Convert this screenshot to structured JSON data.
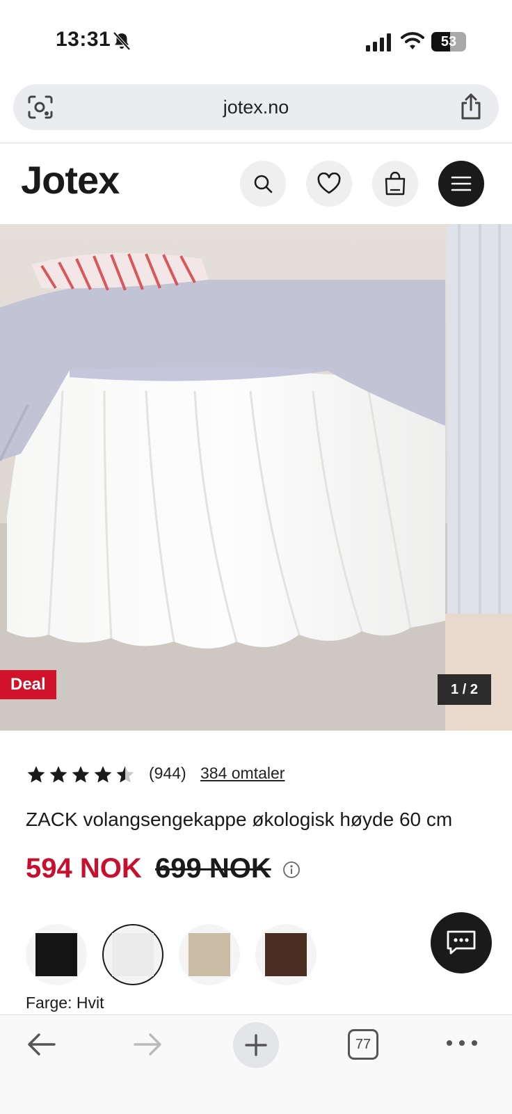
{
  "status_bar": {
    "time": "13:31",
    "battery": "53",
    "battery_level": 0.53
  },
  "browser": {
    "url": "jotex.no",
    "tab_count": "77"
  },
  "header": {
    "logo": "Jotex"
  },
  "gallery": {
    "badge": "Deal",
    "counter": "1 / 2"
  },
  "product": {
    "rating": 4.5,
    "rating_count": "(944)",
    "reviews_link": "384 omtaler",
    "title": "ZACK volangsengekappe økologisk høyde 60 cm",
    "sale_price": "594 NOK",
    "old_price": "699 NOK",
    "color_label": "Farge: Hvit",
    "swatches": [
      {
        "color": "#141414",
        "selected": false
      },
      {
        "color": "#ebebeb",
        "selected": true
      },
      {
        "color": "#c9bba4",
        "selected": false
      },
      {
        "color": "#4a2e22",
        "selected": false
      }
    ]
  },
  "colors": {
    "accent": "#c8102e",
    "deal_badge": "#d0122a",
    "dark": "#1a1a1a"
  },
  "icons": [
    "bell-slash-icon",
    "signal-icon",
    "wifi-icon",
    "camera-search-icon",
    "share-icon",
    "search-icon",
    "heart-icon",
    "shopping-bag-icon",
    "hamburger-menu-icon",
    "info-icon",
    "chat-icon",
    "back-arrow-icon",
    "forward-arrow-icon",
    "plus-icon",
    "more-icon"
  ]
}
